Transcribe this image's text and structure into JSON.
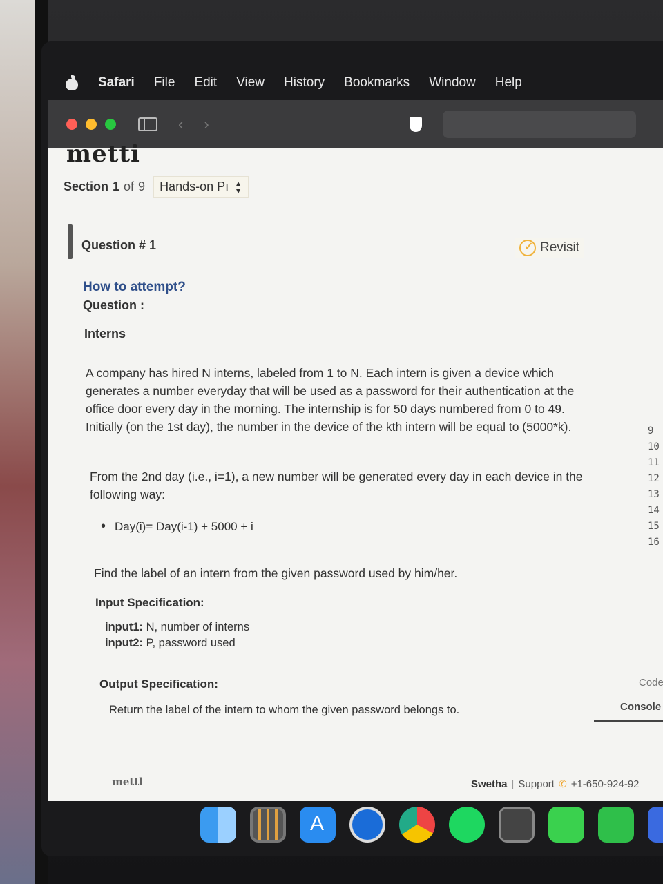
{
  "menubar": {
    "items": [
      "Safari",
      "File",
      "Edit",
      "View",
      "History",
      "Bookmarks",
      "Window",
      "Help"
    ]
  },
  "site": {
    "logo_partial": "metti"
  },
  "section": {
    "label": "Section",
    "current": "1",
    "of": "of",
    "total": "9",
    "selected": "Hands-on Pı"
  },
  "question": {
    "title": "Question # 1",
    "revisit": "Revisit",
    "how_to": "How to attempt?",
    "label": "Question :",
    "problem_title": "Interns",
    "paragraph1": "A company has hired N interns, labeled from 1 to N. Each intern is given a device which generates a number everyday that will be used as a password for their authentication at the office door every day in the morning. The internship is for 50 days numbered from 0 to 49. Initially (on the 1st day), the number in the device of the kth intern will be equal to (5000*k).",
    "paragraph2": "From the 2nd day (i.e., i=1), a new number will be generated every day in each device in the following way:",
    "bullet": "Day(i)= Day(i-1) + 5000 + i",
    "paragraph3": "Find the label of an intern from the given password used by him/her.",
    "input_heading": "Input Specification:",
    "input1_label": "input1:",
    "input1_text": "N, number of interns",
    "input2_label": "input2:",
    "input2_text": "P, password used",
    "output_heading": "Output Specification:",
    "output_text": "Return the label of the intern to whom the given password belongs to."
  },
  "editor": {
    "line_numbers": [
      "9",
      "10",
      "11",
      "12",
      "13",
      "14",
      "15",
      "16"
    ],
    "tab_code": "Code",
    "tab_console": "Console"
  },
  "footer": {
    "logo": "mettl",
    "user": "Swetha",
    "separator": "|",
    "support": "Support",
    "phone": "+1-650-924-92"
  },
  "dock": {
    "apps": [
      "finder-icon",
      "launchpad-icon",
      "appstore-icon",
      "safari-icon",
      "chrome-icon",
      "spotify-icon",
      "calculator-icon",
      "messages-icon",
      "facetime-icon",
      "mail-icon"
    ]
  }
}
